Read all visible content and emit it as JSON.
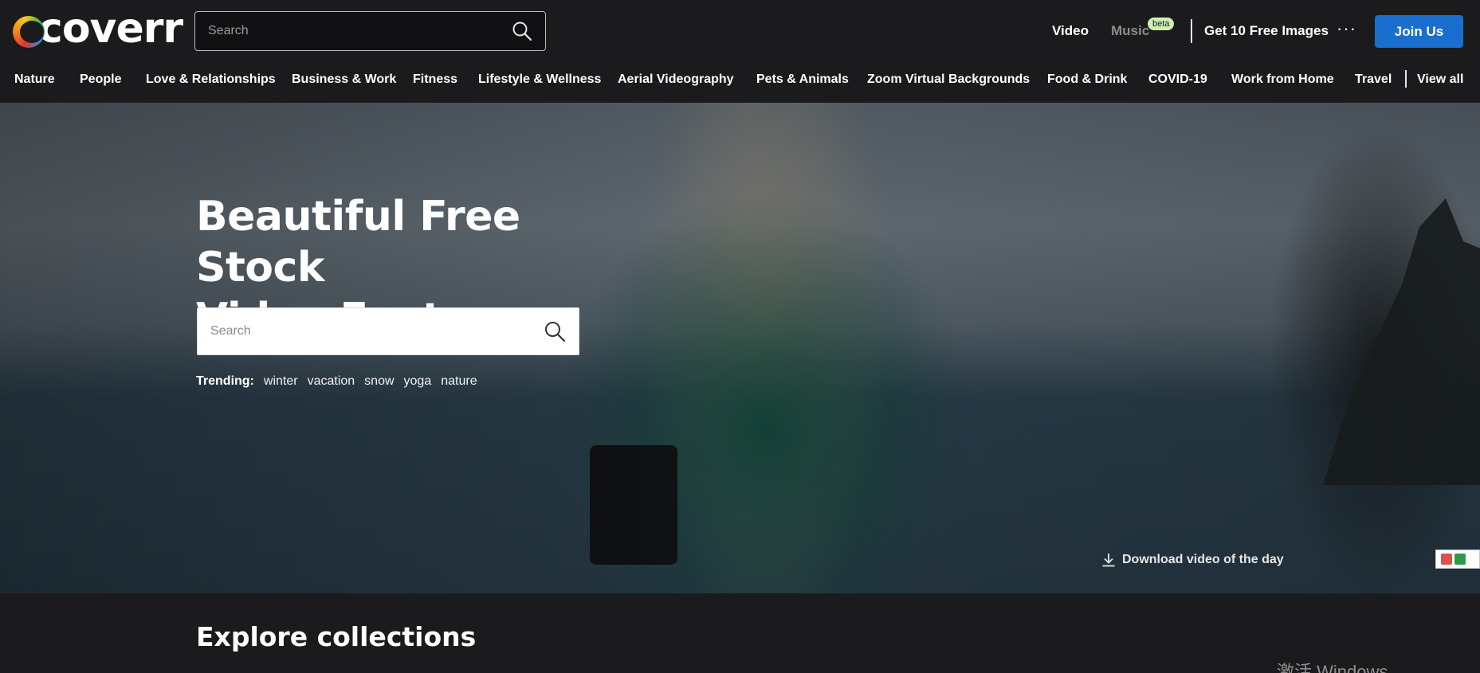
{
  "header": {
    "logo_text": "coverr",
    "search_placeholder": "Search",
    "nav": {
      "video": "Video",
      "music": "Music",
      "music_badge": "beta",
      "free_images": "Get 10 Free Images",
      "more": "···",
      "join": "Join Us"
    }
  },
  "categories": [
    "Nature",
    "People",
    "Love & Relationships",
    "Business & Work",
    "Fitness",
    "Lifestyle & Wellness",
    "Aerial Videography",
    "Pets & Animals",
    "Zoom Virtual Backgrounds",
    "Food & Drink",
    "COVID-19",
    "Work from Home",
    "Travel",
    "View all"
  ],
  "hero": {
    "title_line1": "Beautiful Free Stock",
    "title_line2": "Video Footage",
    "search_placeholder": "Search",
    "trending_label": "Trending:",
    "trending_tags": [
      "winter",
      "vacation",
      "snow",
      "yoga",
      "nature"
    ],
    "download_label": "Download video of the day"
  },
  "section": {
    "explore_title": "Explore collections"
  },
  "watermark": "激活 Windows",
  "colors": {
    "background": "#1b1b1d",
    "accent": "#1a6fce",
    "beta_badge": "#cdeeb4"
  },
  "icons": {
    "search": "search-icon",
    "download": "download-icon",
    "more": "more-dots-icon"
  }
}
